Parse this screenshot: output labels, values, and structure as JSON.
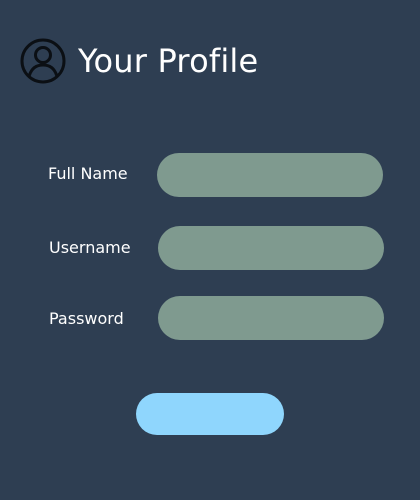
{
  "header": {
    "title": "Your Profile",
    "icon": "user-avatar-icon"
  },
  "form": {
    "fields": [
      {
        "label": "Full Name",
        "value": "",
        "placeholder": ""
      },
      {
        "label": "Username",
        "value": "",
        "placeholder": ""
      },
      {
        "label": "Password",
        "value": "",
        "placeholder": ""
      }
    ],
    "submit_label": ""
  },
  "colors": {
    "background": "#2e3e52",
    "field_fill": "#7f9a8f",
    "button_fill": "#8fd6fd",
    "text": "#ffffff"
  }
}
